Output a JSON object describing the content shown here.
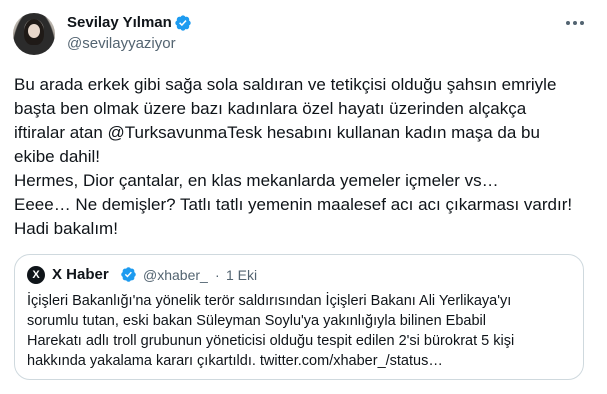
{
  "author": {
    "name": "Sevilay Yılman",
    "handle": "@sevilayyaziyor",
    "verified_color": "#1d9bf0"
  },
  "tweet": {
    "lines": [
      "Bu arada erkek gibi sağa sola saldıran ve tetikçisi olduğu şahsın emriyle",
      "başta ben olmak üzere bazı kadınlara özel hayatı üzerinden alçakça",
      "iftiralar atan  @TurksavunmaTesk hesabını kullanan kadın maşa da bu",
      "ekibe dahil!",
      "Hermes, Dior çantalar, en klas mekanlarda yemeler içmeler vs…",
      "Eeee… Ne demişler? Tatlı tatlı yemenin maalesef acı acı çıkarması vardır!",
      "Hadi bakalım!"
    ]
  },
  "quote": {
    "logo_glyph": "X",
    "name": "X Haber",
    "handle": "@xhaber_",
    "separator": "·",
    "time": "1 Eki",
    "lines": [
      "İçişleri Bakanlığı'na yönelik terör saldırısından İçişleri Bakanı Ali Yerlikaya'yı",
      "sorumlu tutan,  eski bakan Süleyman Soylu'ya yakınlığıyla bilinen Ebabil",
      "Harekatı adlı troll grubunun yöneticisi olduğu tespit edilen 2'si bürokrat 5 kişi",
      "hakkında yakalama kararı çıkartıldı. twitter.com/xhaber_/status…"
    ]
  },
  "icons": {
    "verified": "verified-badge-icon",
    "more": "more-options-icon"
  }
}
